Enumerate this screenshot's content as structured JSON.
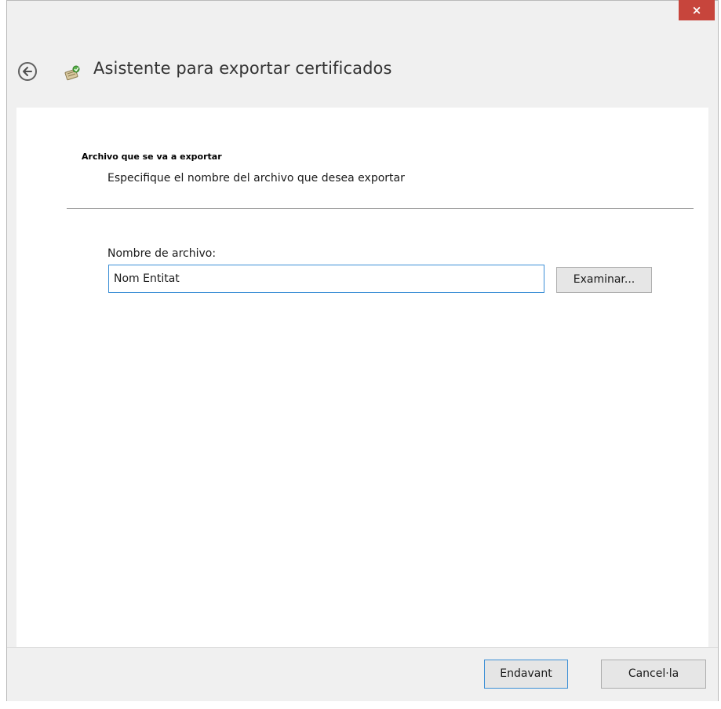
{
  "window": {
    "close_label": "×"
  },
  "header": {
    "title": "Asistente para exportar certificados"
  },
  "section": {
    "title": "Archivo que se va a exportar",
    "description": "Especifique el nombre del archivo que desea exportar"
  },
  "file": {
    "label": "Nombre de archivo:",
    "value": "Nom Entitat",
    "browse_label": "Examinar..."
  },
  "footer": {
    "next_label": "Endavant",
    "cancel_label": "Cancel·la"
  },
  "colors": {
    "close_button": "#c7453c",
    "focus_border": "#3c8fd6",
    "chrome_background": "#f0f0f0"
  },
  "icons": {
    "back": "back-arrow-icon",
    "wizard": "certificate-wizard-icon"
  }
}
